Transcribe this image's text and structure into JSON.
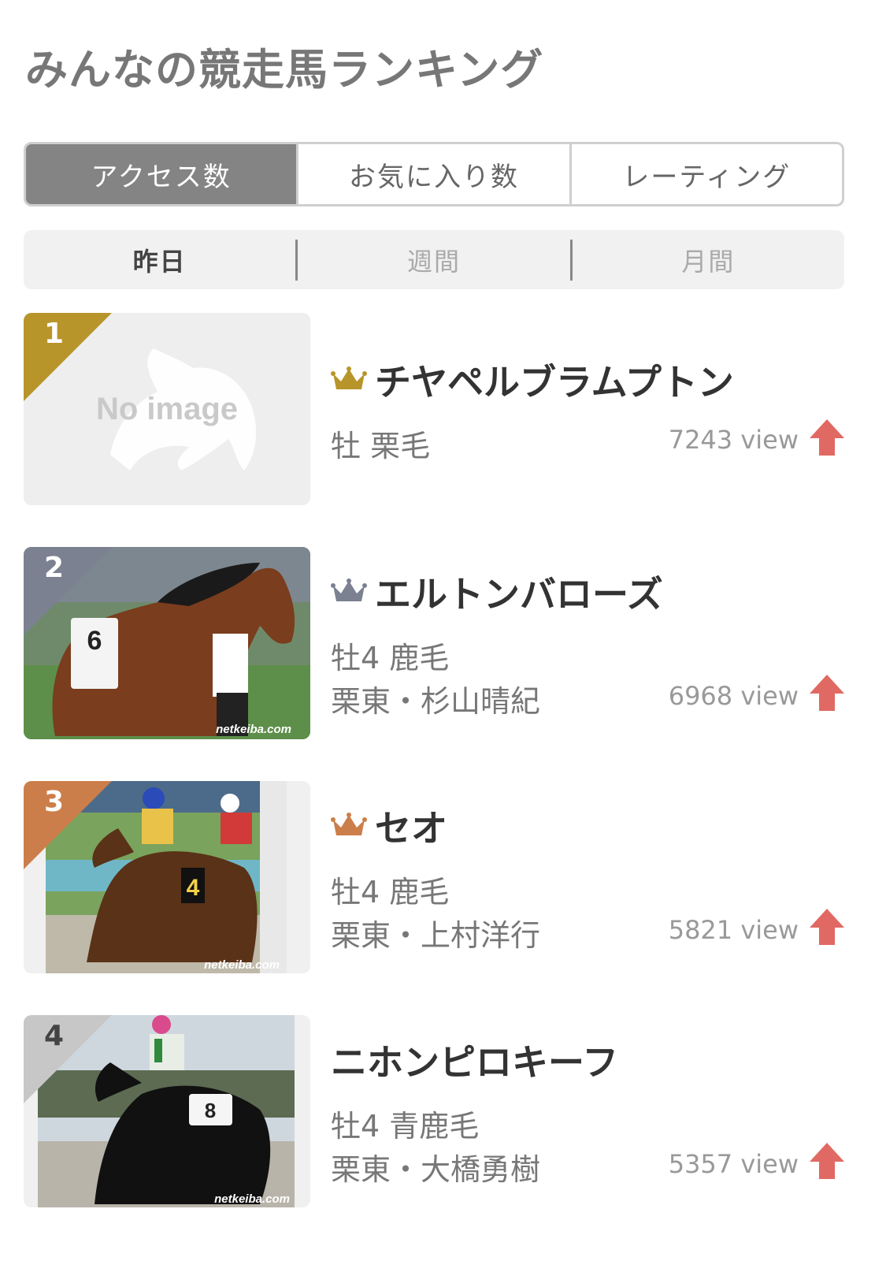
{
  "page": {
    "title": "みんなの競走馬ランキング"
  },
  "tabs": [
    {
      "label": "アクセス数",
      "active": true
    },
    {
      "label": "お気に入り数",
      "active": false
    },
    {
      "label": "レーティング",
      "active": false
    }
  ],
  "periods": [
    {
      "label": "昨日",
      "active": true
    },
    {
      "label": "週間",
      "active": false
    },
    {
      "label": "月間",
      "active": false
    }
  ],
  "colors": {
    "gold": "#b8952b",
    "silver": "#7c8191",
    "bronze": "#cc7e4a",
    "plain": "#c7c7c7",
    "arrow": "#e06a63"
  },
  "rankings": [
    {
      "rank": "1",
      "name": "チヤペルブラムプトン",
      "line1": "牡 栗毛",
      "line2": "",
      "views": "7243 view",
      "crown": "gold",
      "image": {
        "type": "placeholder",
        "text": "No image"
      }
    },
    {
      "rank": "2",
      "name": "エルトンバローズ",
      "line1": "牡4 鹿毛",
      "line2": "栗東・杉山晴紀",
      "views": "6968 view",
      "crown": "silver",
      "image": {
        "type": "photo",
        "watermark": "netkeiba.com"
      }
    },
    {
      "rank": "3",
      "name": "セオ",
      "line1": "牡4 鹿毛",
      "line2": "栗東・上村洋行",
      "views": "5821 view",
      "crown": "bronze",
      "image": {
        "type": "photo",
        "watermark": "netkeiba.com"
      }
    },
    {
      "rank": "4",
      "name": "ニホンピロキーフ",
      "line1": "牡4 青鹿毛",
      "line2": "栗東・大橋勇樹",
      "views": "5357 view",
      "crown": "",
      "image": {
        "type": "photo",
        "watermark": "netkeiba.com"
      }
    }
  ]
}
